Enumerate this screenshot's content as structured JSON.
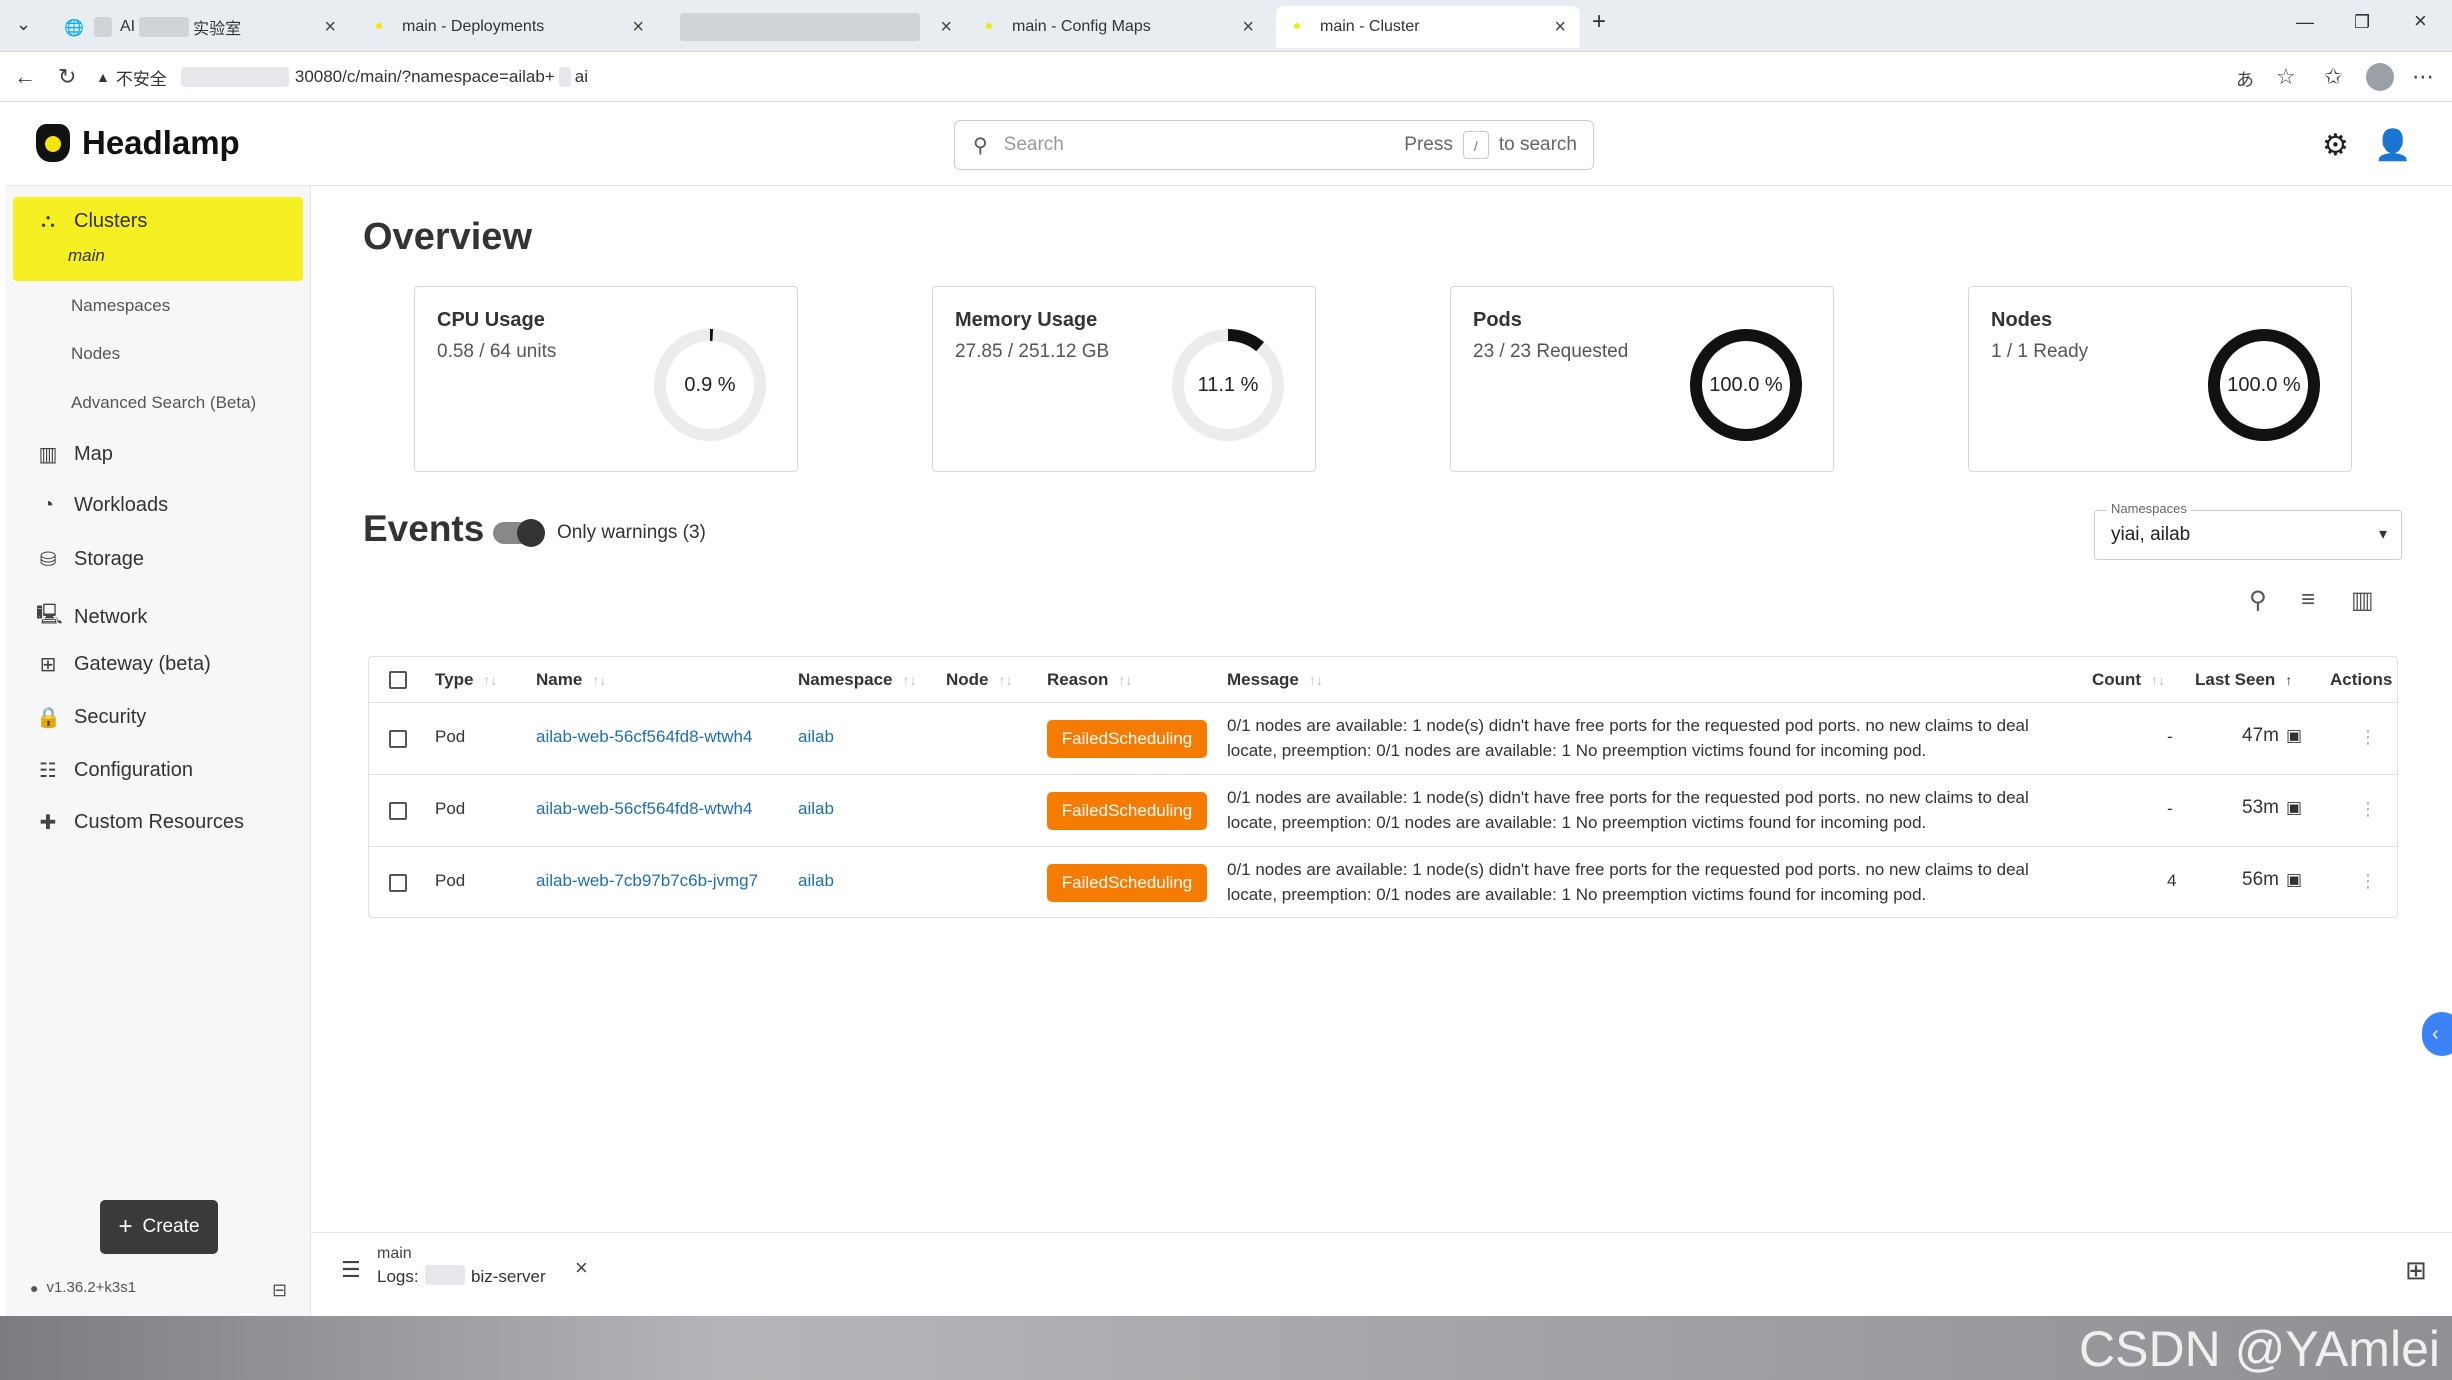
{
  "browser": {
    "tabs": [
      {
        "title": "AI",
        "suffix": "实验室"
      },
      {
        "title": "main - Deployments"
      },
      {
        "title": ""
      },
      {
        "title": "main - Config Maps"
      },
      {
        "title": "main - Cluster"
      }
    ],
    "security_label": "不安全",
    "url": "30080/c/main/?namespace=ailab+",
    "url_tail": "ai"
  },
  "app": {
    "name": "Headlamp",
    "search": {
      "placeholder": "Search",
      "hint_press": "Press",
      "hint_key": "/",
      "hint_suffix": "to search"
    }
  },
  "sidebar": {
    "cluster_label": "Clusters",
    "cluster_name": "main",
    "sub_items": [
      "Namespaces",
      "Nodes",
      "Advanced Search (Beta)"
    ],
    "items": [
      "Map",
      "Workloads",
      "Storage",
      "Network",
      "Gateway (beta)",
      "Security",
      "Configuration",
      "Custom Resources"
    ],
    "create_label": "Create",
    "version": "v1.36.2+k3s1"
  },
  "overview": {
    "title": "Overview",
    "cards": [
      {
        "title": "CPU Usage",
        "subtitle": "0.58 / 64 units",
        "percent_label": "0.9 %",
        "percent": 0.9
      },
      {
        "title": "Memory Usage",
        "subtitle": "27.85 / 251.12 GB",
        "percent_label": "11.1 %",
        "percent": 11.1
      },
      {
        "title": "Pods",
        "subtitle": "23 / 23 Requested",
        "percent_label": "100.0 %",
        "percent": 100
      },
      {
        "title": "Nodes",
        "subtitle": "1 / 1 Ready",
        "percent_label": "100.0 %",
        "percent": 100
      }
    ]
  },
  "events": {
    "title": "Events",
    "only_warnings_label": "Only warnings (3)",
    "only_warnings_on": true,
    "namespaces_label": "Namespaces",
    "namespaces_value": "yiai, ailab",
    "columns": [
      "Type",
      "Name",
      "Namespace",
      "Node",
      "Reason",
      "Message",
      "Count",
      "Last Seen",
      "Actions"
    ],
    "rows": [
      {
        "type": "Pod",
        "name": "ailab-web-56cf564fd8-wtwh4",
        "namespace": "ailab",
        "node": "",
        "reason": "FailedScheduling",
        "message_l1": "0/1 nodes are available: 1 node(s) didn't have free ports for the requested pod ports. no new claims to deal",
        "message_l2": "locate, preemption: 0/1 nodes are available: 1 No preemption victims found for incoming pod.",
        "count": "-",
        "last_seen": "47m"
      },
      {
        "type": "Pod",
        "name": "ailab-web-56cf564fd8-wtwh4",
        "namespace": "ailab",
        "node": "",
        "reason": "FailedScheduling",
        "message_l1": "0/1 nodes are available: 1 node(s) didn't have free ports for the requested pod ports. no new claims to deal",
        "message_l2": "locate, preemption: 0/1 nodes are available: 1 No preemption victims found for incoming pod.",
        "count": "-",
        "last_seen": "53m"
      },
      {
        "type": "Pod",
        "name": "ailab-web-7cb97b7c6b-jvmg7",
        "namespace": "ailab",
        "node": "",
        "reason": "FailedScheduling",
        "message_l1": "0/1 nodes are available: 1 node(s) didn't have free ports for the requested pod ports. no new claims to deal",
        "message_l2": "locate, preemption: 0/1 nodes are available: 1 No preemption victims found for incoming pod.",
        "count": "4",
        "last_seen": "56m"
      }
    ]
  },
  "bottom_bar": {
    "cluster": "main",
    "logs_label": "Logs:",
    "logs_target": "biz-server"
  },
  "watermark": "CSDN @YAmlei",
  "colors": {
    "accent": "#f6ef22",
    "badge": "#f57c00",
    "link": "#1f6fa8",
    "gauge_track": "#ececec",
    "gauge_fill": "#111111"
  }
}
